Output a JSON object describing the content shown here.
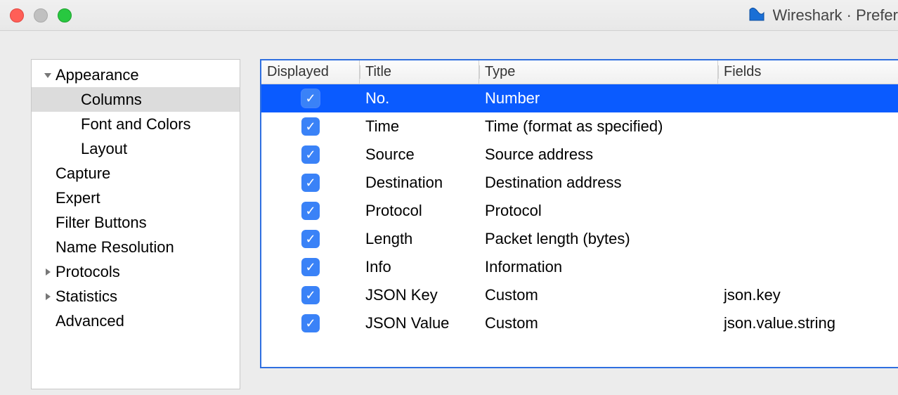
{
  "window": {
    "title": "Wireshark · Prefer"
  },
  "sidebar": {
    "items": [
      {
        "label": "Appearance",
        "level": 1,
        "arrow": "down",
        "selected": false
      },
      {
        "label": "Columns",
        "level": 2,
        "arrow": "none",
        "selected": true
      },
      {
        "label": "Font and Colors",
        "level": 2,
        "arrow": "none",
        "selected": false
      },
      {
        "label": "Layout",
        "level": 2,
        "arrow": "none",
        "selected": false
      },
      {
        "label": "Capture",
        "level": 1,
        "arrow": "none",
        "selected": false
      },
      {
        "label": "Expert",
        "level": 1,
        "arrow": "none",
        "selected": false
      },
      {
        "label": "Filter Buttons",
        "level": 1,
        "arrow": "none",
        "selected": false
      },
      {
        "label": "Name Resolution",
        "level": 1,
        "arrow": "none",
        "selected": false
      },
      {
        "label": "Protocols",
        "level": 1,
        "arrow": "right",
        "selected": false
      },
      {
        "label": "Statistics",
        "level": 1,
        "arrow": "right",
        "selected": false
      },
      {
        "label": "Advanced",
        "level": 1,
        "arrow": "none",
        "selected": false
      }
    ]
  },
  "table": {
    "headers": {
      "displayed": "Displayed",
      "title": "Title",
      "type": "Type",
      "fields": "Fields"
    },
    "rows": [
      {
        "displayed": true,
        "title": "No.",
        "type": "Number",
        "fields": "",
        "selected": true
      },
      {
        "displayed": true,
        "title": "Time",
        "type": "Time (format as specified)",
        "fields": "",
        "selected": false
      },
      {
        "displayed": true,
        "title": "Source",
        "type": "Source address",
        "fields": "",
        "selected": false
      },
      {
        "displayed": true,
        "title": "Destination",
        "type": "Destination address",
        "fields": "",
        "selected": false
      },
      {
        "displayed": true,
        "title": "Protocol",
        "type": "Protocol",
        "fields": "",
        "selected": false
      },
      {
        "displayed": true,
        "title": "Length",
        "type": "Packet length (bytes)",
        "fields": "",
        "selected": false
      },
      {
        "displayed": true,
        "title": "Info",
        "type": "Information",
        "fields": "",
        "selected": false
      },
      {
        "displayed": true,
        "title": "JSON Key",
        "type": "Custom",
        "fields": "json.key",
        "selected": false
      },
      {
        "displayed": true,
        "title": "JSON Value",
        "type": "Custom",
        "fields": "json.value.string",
        "selected": false
      }
    ]
  }
}
